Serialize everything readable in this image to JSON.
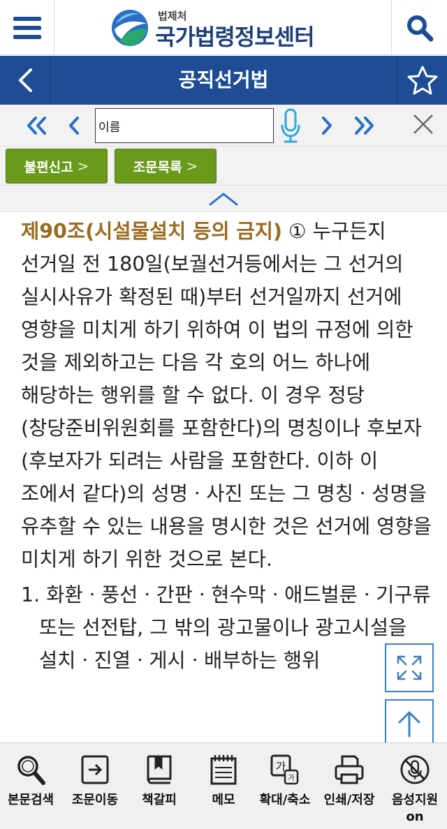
{
  "header": {
    "org": "법제처",
    "site": "국가법령정보센터"
  },
  "titlebar": {
    "title": "공직선거법"
  },
  "search": {
    "value": "이름"
  },
  "buttons": {
    "report": "불편신고",
    "article_list": "조문목록"
  },
  "content": {
    "article_head": "제90조(시설물설치 등의 금지)",
    "body": "① 누구든지 선거일 전 180일(보궐선거등에서는 그 선거의 실시사유가 확정된 때)부터 선거일까지 선거에 영향을 미치게 하기 위하여 이 법의 규정에 의한 것을 제외하고는 다음 각 호의 어느 하나에 해당하는 행위를 할 수 없다. 이 경우 정당(창당준비위원회를 포함한다)의 명칭이나 후보자(후보자가 되려는 사람을 포함한다. 이하 이 조에서 같다)의 성명ㆍ사진 또는 그 명칭ㆍ성명을 유추할 수 있는 내용을 명시한 것은 선거에 영향을 미치게 하기 위한 것으로 본다.",
    "items": [
      "1. 화환ㆍ풍선ㆍ간판ㆍ현수막ㆍ애드벌룬ㆍ기구류 또는 선전탑, 그 밖의 광고물이나 광고시설을 설치ㆍ진열ㆍ게시ㆍ배부하는 행위"
    ]
  },
  "toolbar": {
    "search_text": "본문검색",
    "move_article": "조문이동",
    "bookmark": "책갈피",
    "memo": "메모",
    "zoom": "확대/축소",
    "print_save": "인쇄/저장",
    "voice": "음성지원 on"
  },
  "colors": {
    "title_bar": "#1f4d95",
    "green_button": "#6a9a1c",
    "article_head": "#9a6a1e",
    "accent_blue": "#2a6fc4"
  }
}
